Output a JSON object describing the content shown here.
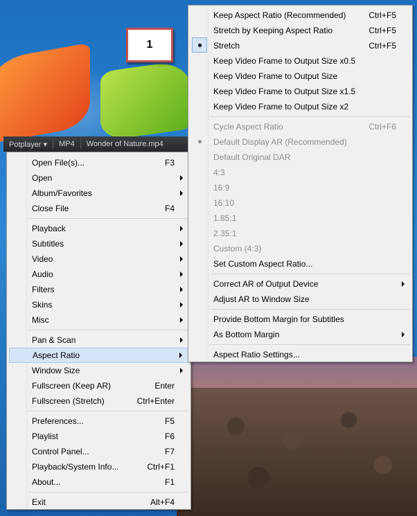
{
  "callout": {
    "number": "1"
  },
  "titlebar": {
    "app": "Potplayer ▾",
    "format": "MP4",
    "file": "Wonder of Nature.mp4"
  },
  "main_menu": {
    "items": [
      {
        "label": "Open File(s)...",
        "shortcut": "F3"
      },
      {
        "label": "Open",
        "submenu": true
      },
      {
        "label": "Album/Favorites",
        "submenu": true
      },
      {
        "label": "Close File",
        "shortcut": "F4"
      },
      {
        "label": "Playback",
        "submenu": true
      },
      {
        "label": "Subtitles",
        "submenu": true
      },
      {
        "label": "Video",
        "submenu": true
      },
      {
        "label": "Audio",
        "submenu": true
      },
      {
        "label": "Filters",
        "submenu": true
      },
      {
        "label": "Skins",
        "submenu": true
      },
      {
        "label": "Misc",
        "submenu": true
      },
      {
        "label": "Pan & Scan",
        "submenu": true
      },
      {
        "label": "Aspect Ratio",
        "submenu": true,
        "highlighted": true
      },
      {
        "label": "Window Size",
        "submenu": true
      },
      {
        "label": "Fullscreen (Keep AR)",
        "shortcut": "Enter"
      },
      {
        "label": "Fullscreen (Stretch)",
        "shortcut": "Ctrl+Enter"
      },
      {
        "label": "Preferences...",
        "shortcut": "F5"
      },
      {
        "label": "Playlist",
        "shortcut": "F6"
      },
      {
        "label": "Control Panel...",
        "shortcut": "F7"
      },
      {
        "label": "Playback/System Info...",
        "shortcut": "Ctrl+F1"
      },
      {
        "label": "About...",
        "shortcut": "F1"
      },
      {
        "label": "Exit",
        "shortcut": "Alt+F4"
      }
    ]
  },
  "aspect_menu": {
    "items": [
      {
        "label": "Keep Aspect Ratio (Recommended)",
        "shortcut": "Ctrl+F5"
      },
      {
        "label": "Stretch by Keeping Aspect Ratio",
        "shortcut": "Ctrl+F5"
      },
      {
        "label": "Stretch",
        "shortcut": "Ctrl+F5",
        "selected": true
      },
      {
        "label": "Keep Video Frame to Output Size x0.5"
      },
      {
        "label": "Keep Video Frame to Output Size"
      },
      {
        "label": "Keep Video Frame to Output Size x1.5"
      },
      {
        "label": "Keep Video Frame to Output Size x2"
      },
      {
        "label": "Cycle Aspect Ratio",
        "shortcut": "Ctrl+F6",
        "disabled": true
      },
      {
        "label": "Default Display AR (Recommended)",
        "disabled": true,
        "selected": true
      },
      {
        "label": "Default Original DAR",
        "disabled": true
      },
      {
        "label": "4:3",
        "disabled": true
      },
      {
        "label": "16:9",
        "disabled": true
      },
      {
        "label": "16:10",
        "disabled": true
      },
      {
        "label": "1.85:1",
        "disabled": true
      },
      {
        "label": "2.35:1",
        "disabled": true
      },
      {
        "label": "Custom (4:3)",
        "disabled": true
      },
      {
        "label": "Set Custom Aspect Ratio..."
      },
      {
        "label": "Correct AR of Output Device",
        "submenu": true
      },
      {
        "label": "Adjust AR to Window Size"
      },
      {
        "label": "Provide Bottom Margin for Subtitles"
      },
      {
        "label": "As Bottom Margin",
        "submenu": true
      },
      {
        "label": "Aspect Ratio Settings..."
      }
    ]
  }
}
